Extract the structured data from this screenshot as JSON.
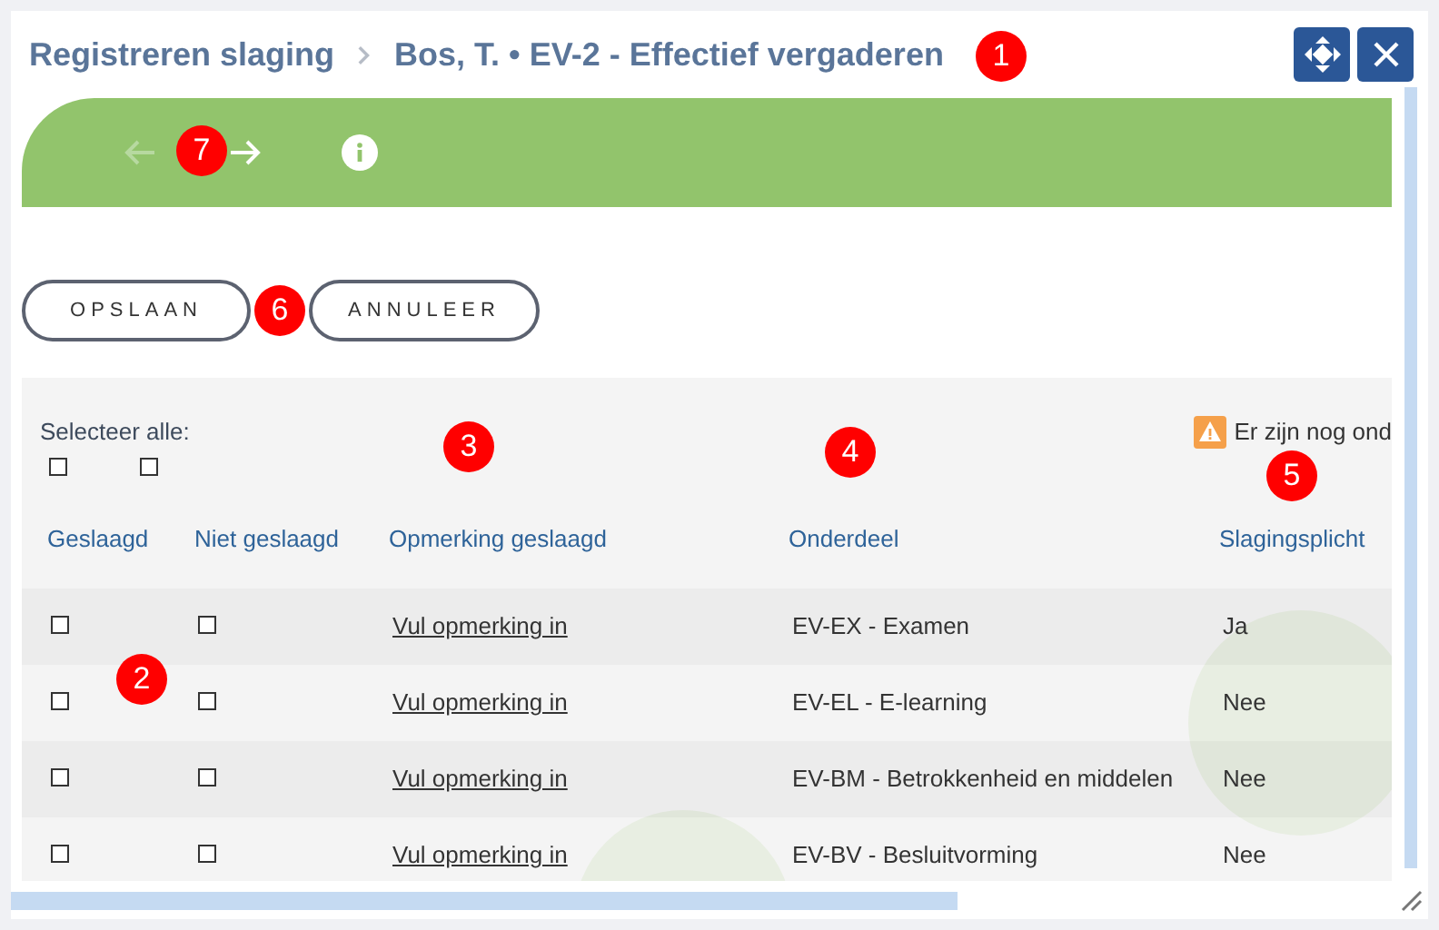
{
  "breadcrumb": [
    {
      "label": "Registreren slaging"
    },
    {
      "label": "Bos, T. • EV-2 - Effectief vergaderen"
    }
  ],
  "banner": {
    "back_disabled": true
  },
  "buttons": [
    "OPSLAAN",
    "ANNULEER"
  ],
  "select_all": {
    "label": "Selecteer alle:",
    "geslaagd_checked": false,
    "niet_geslaagd_checked": false
  },
  "warning": "Er zijn nog ond",
  "columns": [
    "Geslaagd",
    "Niet geslaagd",
    "Opmerking geslaagd",
    "Onderdeel",
    "Slagingsplicht"
  ],
  "rows": [
    {
      "geslaagd": false,
      "niet_geslaagd": false,
      "opmerking": "Vul opmerking in",
      "onderdeel": "EV-EX - Examen",
      "slagingsplicht": "Ja"
    },
    {
      "geslaagd": false,
      "niet_geslaagd": false,
      "opmerking": "Vul opmerking in",
      "onderdeel": "EV-EL - E-learning",
      "slagingsplicht": "Nee"
    },
    {
      "geslaagd": false,
      "niet_geslaagd": false,
      "opmerking": "Vul opmerking in",
      "onderdeel": "EV-BM - Betrokkenheid en middelen",
      "slagingsplicht": "Nee"
    },
    {
      "geslaagd": false,
      "niet_geslaagd": false,
      "opmerking": "Vul opmerking in",
      "onderdeel": "EV-BV - Besluitvorming",
      "slagingsplicht": "Nee"
    }
  ],
  "annotations": [
    "1",
    "7",
    "6",
    "3",
    "4",
    "5",
    "2"
  ]
}
